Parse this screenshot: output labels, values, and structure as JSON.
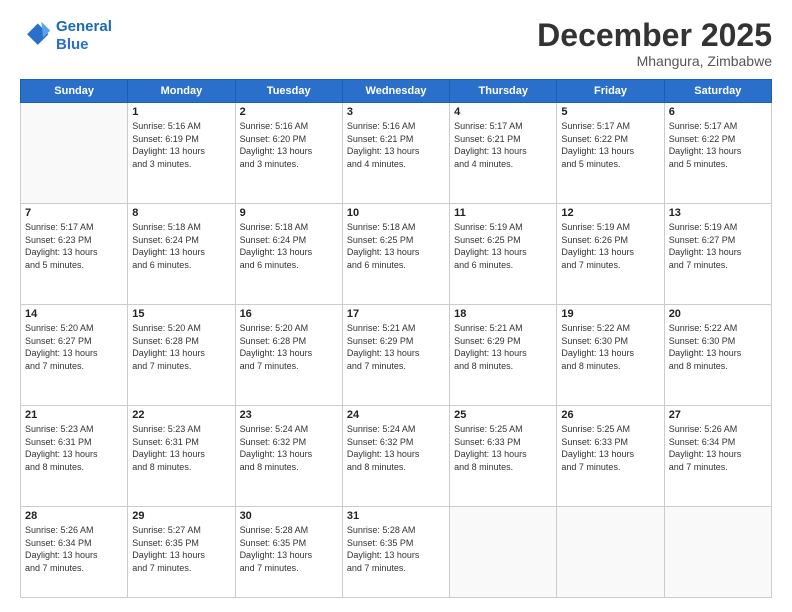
{
  "logo": {
    "line1": "General",
    "line2": "Blue"
  },
  "title": "December 2025",
  "location": "Mhangura, Zimbabwe",
  "days_header": [
    "Sunday",
    "Monday",
    "Tuesday",
    "Wednesday",
    "Thursday",
    "Friday",
    "Saturday"
  ],
  "weeks": [
    [
      {
        "num": "",
        "info": ""
      },
      {
        "num": "1",
        "info": "Sunrise: 5:16 AM\nSunset: 6:19 PM\nDaylight: 13 hours\nand 3 minutes."
      },
      {
        "num": "2",
        "info": "Sunrise: 5:16 AM\nSunset: 6:20 PM\nDaylight: 13 hours\nand 3 minutes."
      },
      {
        "num": "3",
        "info": "Sunrise: 5:16 AM\nSunset: 6:21 PM\nDaylight: 13 hours\nand 4 minutes."
      },
      {
        "num": "4",
        "info": "Sunrise: 5:17 AM\nSunset: 6:21 PM\nDaylight: 13 hours\nand 4 minutes."
      },
      {
        "num": "5",
        "info": "Sunrise: 5:17 AM\nSunset: 6:22 PM\nDaylight: 13 hours\nand 5 minutes."
      },
      {
        "num": "6",
        "info": "Sunrise: 5:17 AM\nSunset: 6:22 PM\nDaylight: 13 hours\nand 5 minutes."
      }
    ],
    [
      {
        "num": "7",
        "info": "Sunrise: 5:17 AM\nSunset: 6:23 PM\nDaylight: 13 hours\nand 5 minutes."
      },
      {
        "num": "8",
        "info": "Sunrise: 5:18 AM\nSunset: 6:24 PM\nDaylight: 13 hours\nand 6 minutes."
      },
      {
        "num": "9",
        "info": "Sunrise: 5:18 AM\nSunset: 6:24 PM\nDaylight: 13 hours\nand 6 minutes."
      },
      {
        "num": "10",
        "info": "Sunrise: 5:18 AM\nSunset: 6:25 PM\nDaylight: 13 hours\nand 6 minutes."
      },
      {
        "num": "11",
        "info": "Sunrise: 5:19 AM\nSunset: 6:25 PM\nDaylight: 13 hours\nand 6 minutes."
      },
      {
        "num": "12",
        "info": "Sunrise: 5:19 AM\nSunset: 6:26 PM\nDaylight: 13 hours\nand 7 minutes."
      },
      {
        "num": "13",
        "info": "Sunrise: 5:19 AM\nSunset: 6:27 PM\nDaylight: 13 hours\nand 7 minutes."
      }
    ],
    [
      {
        "num": "14",
        "info": "Sunrise: 5:20 AM\nSunset: 6:27 PM\nDaylight: 13 hours\nand 7 minutes."
      },
      {
        "num": "15",
        "info": "Sunrise: 5:20 AM\nSunset: 6:28 PM\nDaylight: 13 hours\nand 7 minutes."
      },
      {
        "num": "16",
        "info": "Sunrise: 5:20 AM\nSunset: 6:28 PM\nDaylight: 13 hours\nand 7 minutes."
      },
      {
        "num": "17",
        "info": "Sunrise: 5:21 AM\nSunset: 6:29 PM\nDaylight: 13 hours\nand 7 minutes."
      },
      {
        "num": "18",
        "info": "Sunrise: 5:21 AM\nSunset: 6:29 PM\nDaylight: 13 hours\nand 8 minutes."
      },
      {
        "num": "19",
        "info": "Sunrise: 5:22 AM\nSunset: 6:30 PM\nDaylight: 13 hours\nand 8 minutes."
      },
      {
        "num": "20",
        "info": "Sunrise: 5:22 AM\nSunset: 6:30 PM\nDaylight: 13 hours\nand 8 minutes."
      }
    ],
    [
      {
        "num": "21",
        "info": "Sunrise: 5:23 AM\nSunset: 6:31 PM\nDaylight: 13 hours\nand 8 minutes."
      },
      {
        "num": "22",
        "info": "Sunrise: 5:23 AM\nSunset: 6:31 PM\nDaylight: 13 hours\nand 8 minutes."
      },
      {
        "num": "23",
        "info": "Sunrise: 5:24 AM\nSunset: 6:32 PM\nDaylight: 13 hours\nand 8 minutes."
      },
      {
        "num": "24",
        "info": "Sunrise: 5:24 AM\nSunset: 6:32 PM\nDaylight: 13 hours\nand 8 minutes."
      },
      {
        "num": "25",
        "info": "Sunrise: 5:25 AM\nSunset: 6:33 PM\nDaylight: 13 hours\nand 8 minutes."
      },
      {
        "num": "26",
        "info": "Sunrise: 5:25 AM\nSunset: 6:33 PM\nDaylight: 13 hours\nand 7 minutes."
      },
      {
        "num": "27",
        "info": "Sunrise: 5:26 AM\nSunset: 6:34 PM\nDaylight: 13 hours\nand 7 minutes."
      }
    ],
    [
      {
        "num": "28",
        "info": "Sunrise: 5:26 AM\nSunset: 6:34 PM\nDaylight: 13 hours\nand 7 minutes."
      },
      {
        "num": "29",
        "info": "Sunrise: 5:27 AM\nSunset: 6:35 PM\nDaylight: 13 hours\nand 7 minutes."
      },
      {
        "num": "30",
        "info": "Sunrise: 5:28 AM\nSunset: 6:35 PM\nDaylight: 13 hours\nand 7 minutes."
      },
      {
        "num": "31",
        "info": "Sunrise: 5:28 AM\nSunset: 6:35 PM\nDaylight: 13 hours\nand 7 minutes."
      },
      {
        "num": "",
        "info": ""
      },
      {
        "num": "",
        "info": ""
      },
      {
        "num": "",
        "info": ""
      }
    ]
  ]
}
